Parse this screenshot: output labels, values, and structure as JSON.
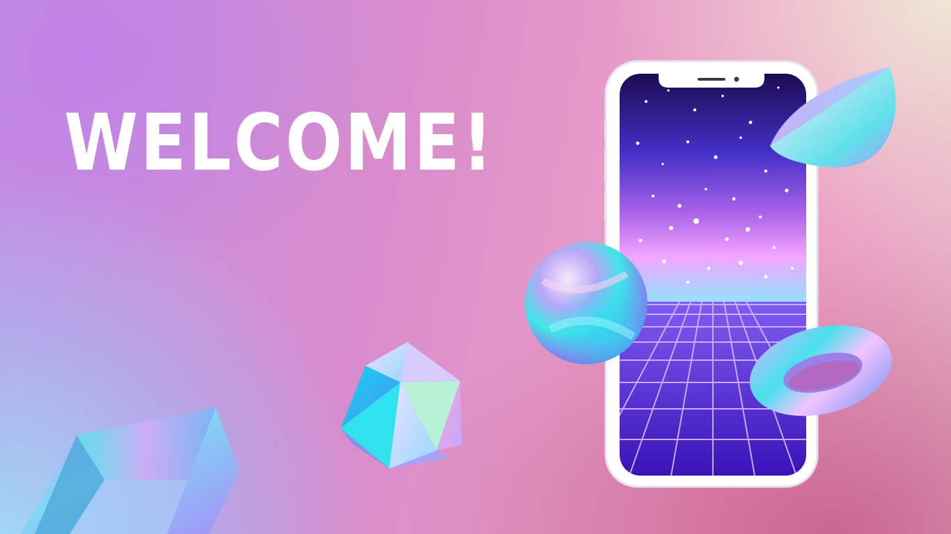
{
  "headline": "WELCOME!",
  "colors": {
    "text": "#ffffff",
    "bg_purple": "#c690e2",
    "bg_pink": "#e59ac8",
    "bg_cream": "#f0e8d6",
    "neon_grid": "#b68bff"
  },
  "scene": {
    "phone": "smartphone-icon",
    "shapes": [
      "hemisphere-shape",
      "sphere-shape",
      "torus-shape",
      "icosahedron-shape",
      "frame-shape"
    ]
  }
}
